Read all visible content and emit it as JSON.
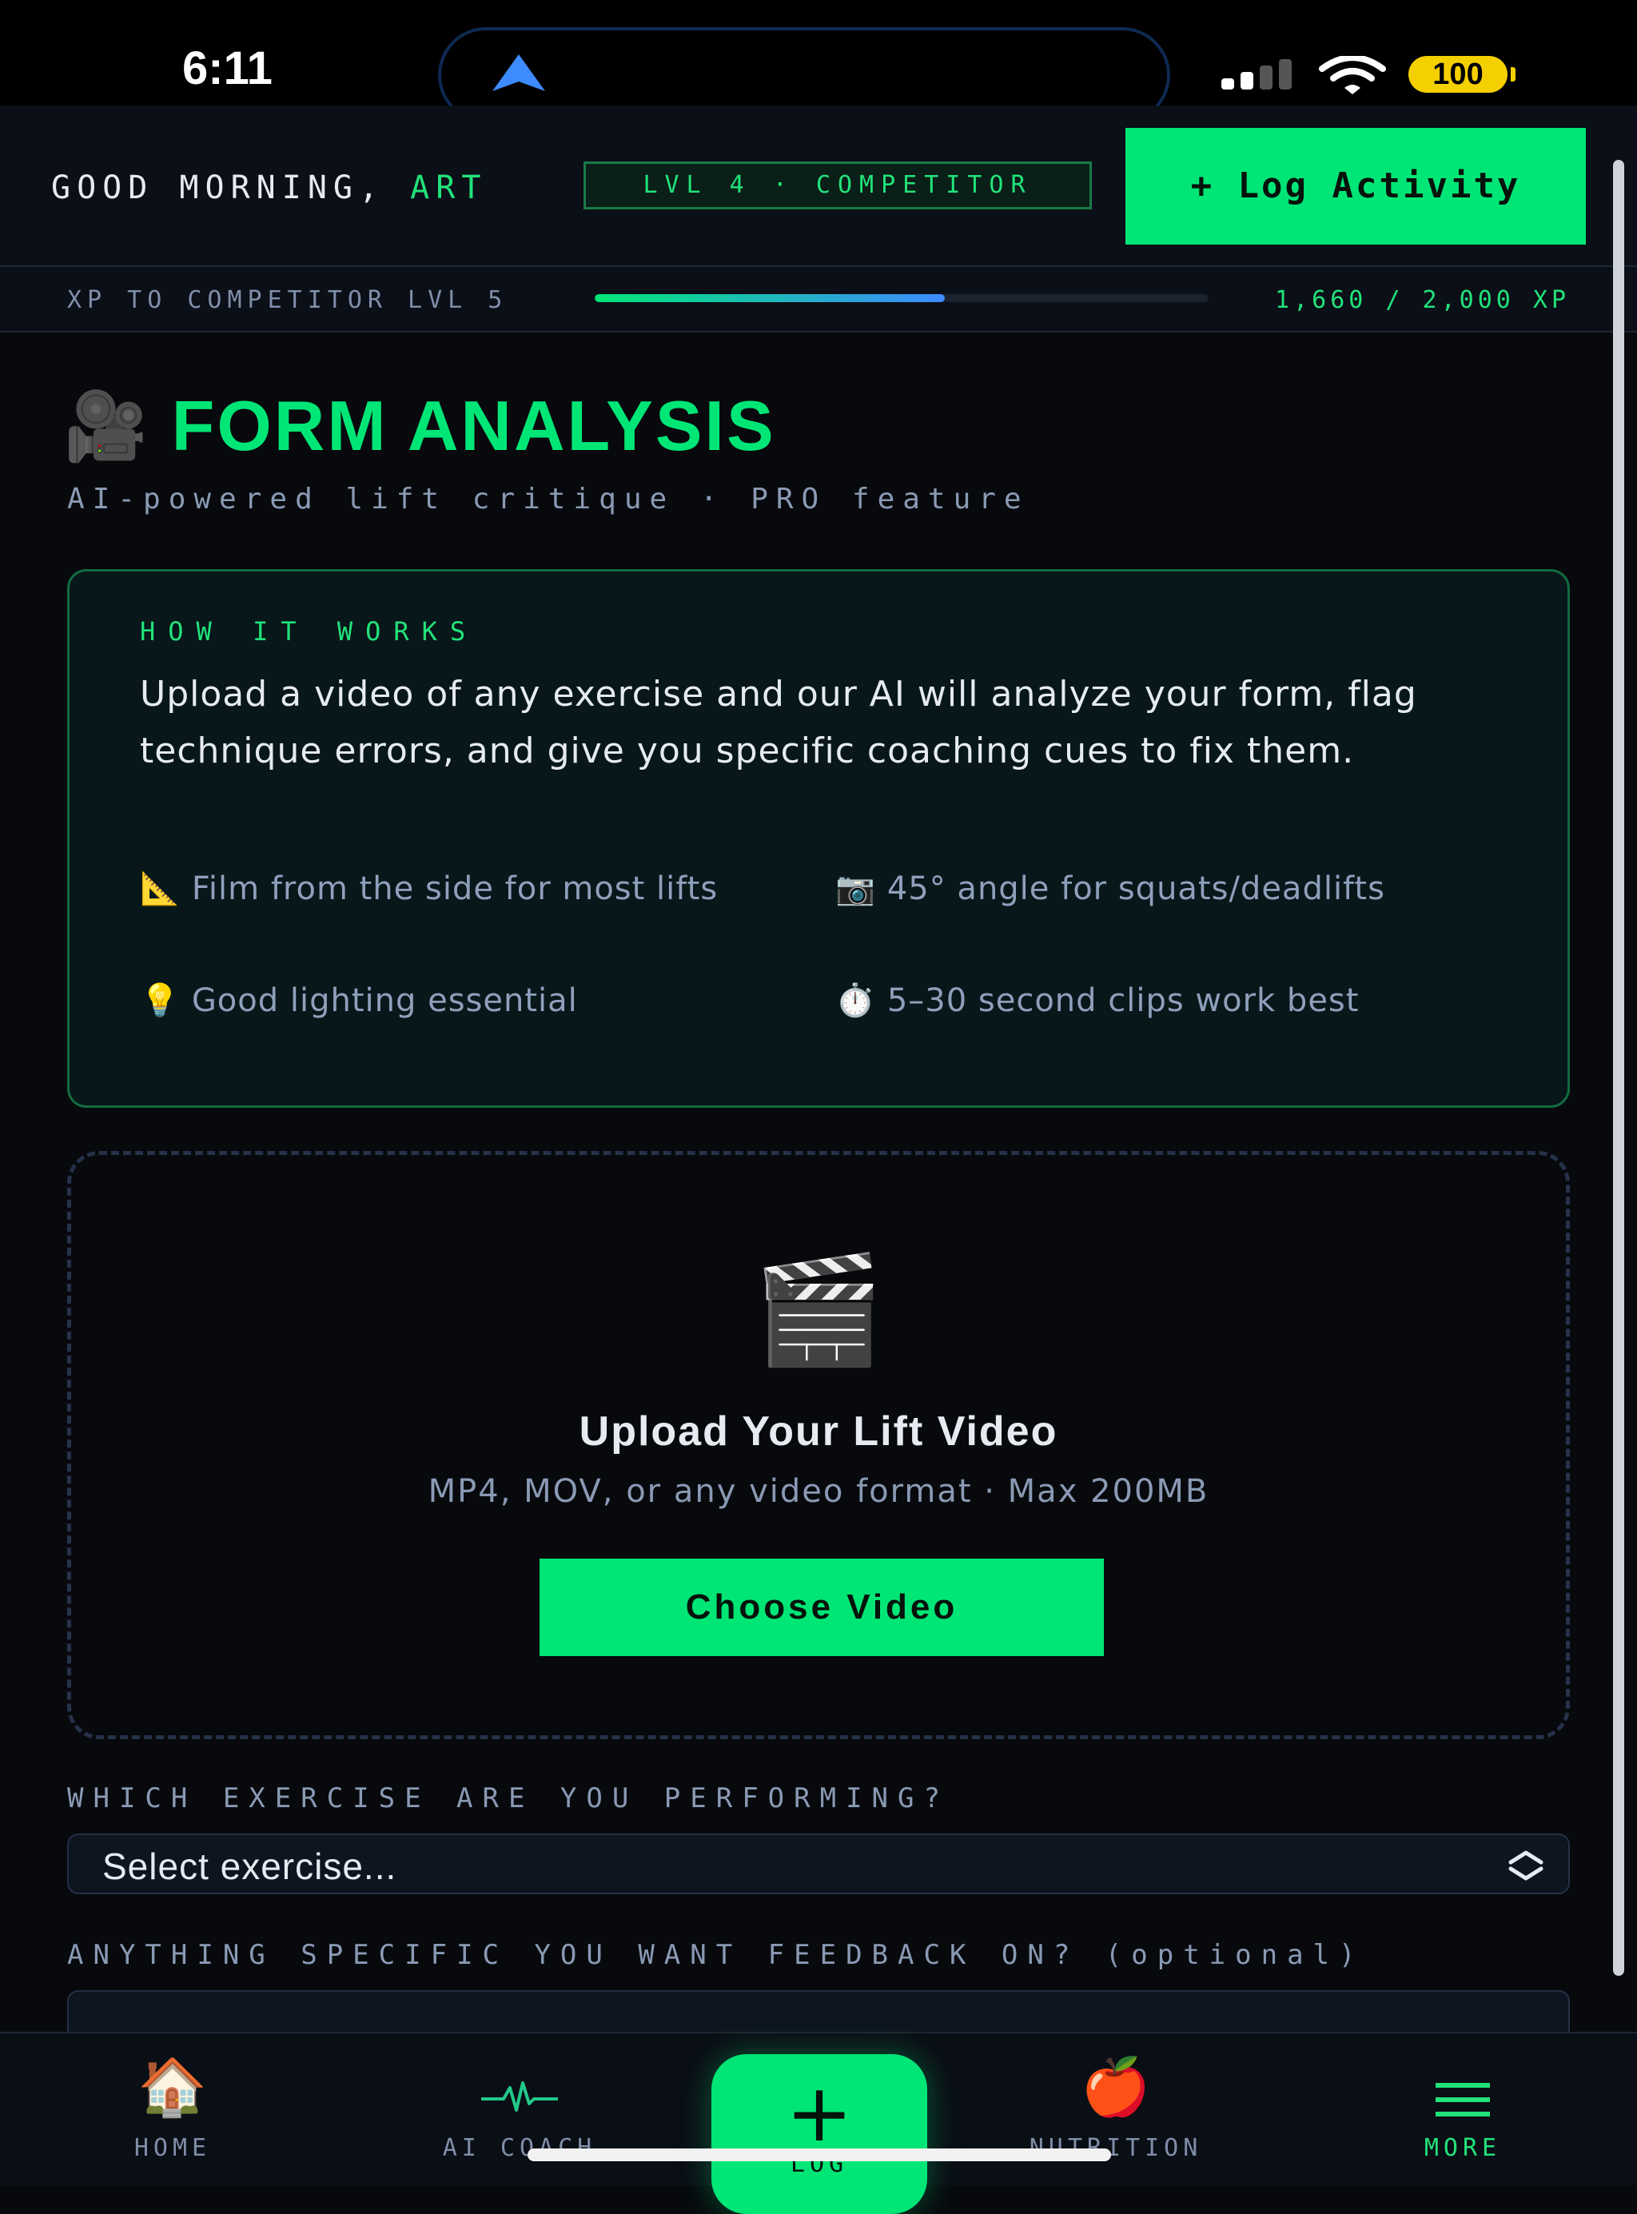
{
  "status_bar": {
    "time": "6:11",
    "battery": "100"
  },
  "header": {
    "greeting_prefix": "GOOD MORNING, ",
    "user_name": "ART",
    "level_badge": "LVL 4 · COMPETITOR",
    "log_activity_label": "+ Log Activity"
  },
  "xp": {
    "label": "XP TO COMPETITOR LVL 5",
    "value_text": "1,660 / 2,000 XP",
    "current": 1660,
    "target": 2000,
    "fill_fraction": 0.57
  },
  "page": {
    "icon": "🎥",
    "title": "FORM ANALYSIS",
    "subtitle": "AI-powered lift critique · PRO feature"
  },
  "how_it_works": {
    "heading": "HOW IT WORKS",
    "body": "Upload a video of any exercise and our AI will analyze your form, flag technique errors, and give you specific coaching cues to fix them.",
    "tips": [
      {
        "icon": "📐",
        "text": "Film from the side for most lifts"
      },
      {
        "icon": "📷",
        "text": "45° angle for squats/deadlifts"
      },
      {
        "icon": "💡",
        "text": "Good lighting essential"
      },
      {
        "icon": "⏱️",
        "text": "5–30 second clips work best"
      }
    ]
  },
  "upload": {
    "icon": "🎬",
    "title": "Upload Your Lift Video",
    "hint": "MP4, MOV, or any video format · Max 200MB",
    "button_label": "Choose Video"
  },
  "form": {
    "exercise_label": "WHICH EXERCISE ARE YOU PERFORMING?",
    "exercise_value": "Select exercise...",
    "feedback_label": "ANYTHING SPECIFIC YOU WANT FEEDBACK ON? (optional)"
  },
  "bottom_nav": {
    "home": {
      "icon": "🏠",
      "label": "HOME"
    },
    "ai_coach": {
      "icon": "heartbeat-icon",
      "label": "AI COACH"
    },
    "log": {
      "icon": "+",
      "label": "LOG"
    },
    "nutrition": {
      "icon": "🍎",
      "label": "NUTRITION"
    },
    "more": {
      "icon": "menu-icon",
      "label": "MORE"
    }
  },
  "colors": {
    "accent": "#00e676",
    "background": "#07090d",
    "muted_text": "#8a9ab4",
    "xp_gradient_end": "#3d8bff"
  }
}
